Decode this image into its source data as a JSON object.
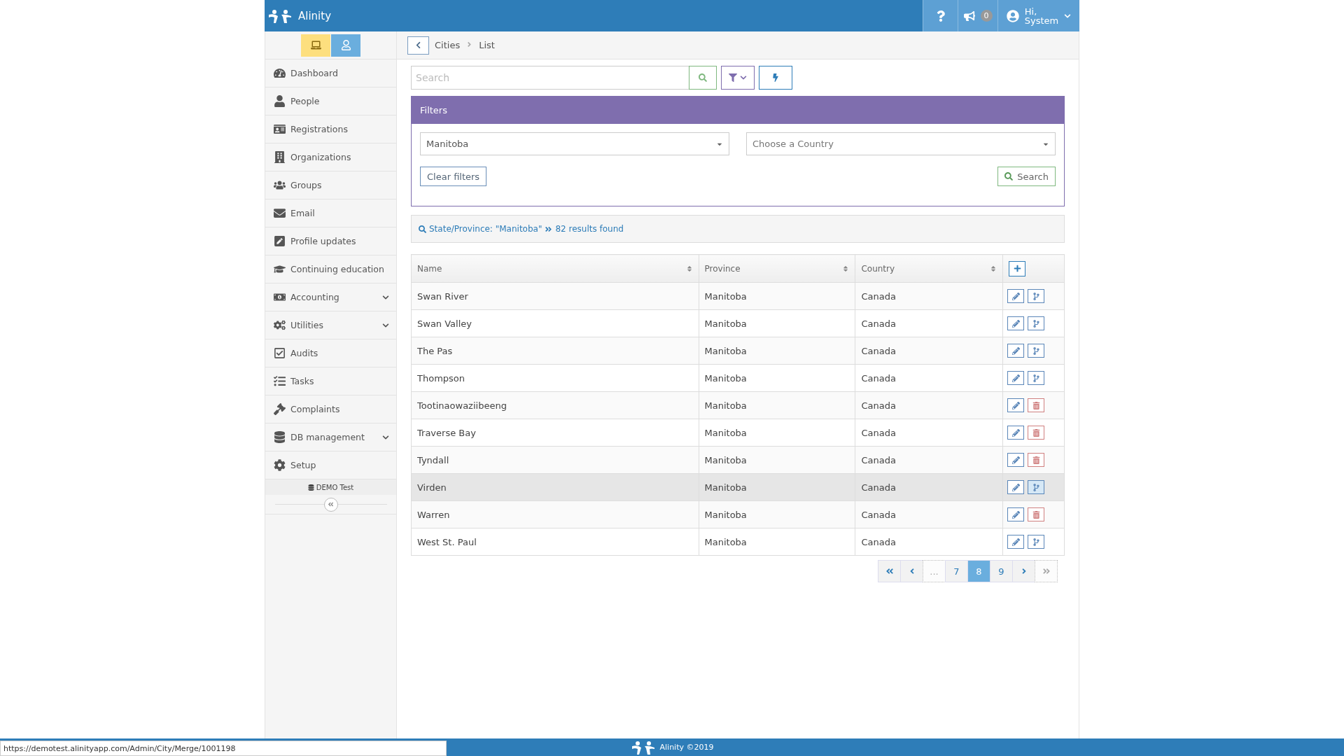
{
  "topbar": {
    "brand": "Alinity",
    "notifications": "0",
    "greeting": "Hi,",
    "user": "System"
  },
  "sidebar": {
    "toggles": [
      {
        "selected": true
      },
      {
        "selected": false
      }
    ],
    "items": [
      {
        "label": "Dashboard",
        "expandable": false
      },
      {
        "label": "People",
        "expandable": false
      },
      {
        "label": "Registrations",
        "expandable": false
      },
      {
        "label": "Organizations",
        "expandable": false
      },
      {
        "label": "Groups",
        "expandable": false
      },
      {
        "label": "Email",
        "expandable": false
      },
      {
        "label": "Profile updates",
        "expandable": false
      },
      {
        "label": "Continuing education",
        "expandable": false
      },
      {
        "label": "Accounting",
        "expandable": true
      },
      {
        "label": "Utilities",
        "expandable": true
      },
      {
        "label": "Audits",
        "expandable": false
      },
      {
        "label": "Tasks",
        "expandable": false
      },
      {
        "label": "Complaints",
        "expandable": false
      },
      {
        "label": "DB management",
        "expandable": true
      },
      {
        "label": "Setup",
        "expandable": false
      }
    ],
    "database": "DEMO Test"
  },
  "breadcrumb": [
    "Cities",
    "List"
  ],
  "search": {
    "placeholder": "Search"
  },
  "filters": {
    "title": "Filters",
    "state": "Manitoba",
    "country_placeholder": "Choose a Country",
    "clear": "Clear filters",
    "search": "Search"
  },
  "results": {
    "criteria": "State/Province: \"Manitoba\"",
    "count": "82 results found"
  },
  "table": {
    "columns": [
      "Name",
      "Province",
      "Country"
    ],
    "rows": [
      {
        "cells": [
          "Swan River",
          "Manitoba",
          "Canada"
        ],
        "kind": "merge",
        "hovered": false
      },
      {
        "cells": [
          "Swan Valley",
          "Manitoba",
          "Canada"
        ],
        "kind": "merge",
        "hovered": false
      },
      {
        "cells": [
          "The Pas",
          "Manitoba",
          "Canada"
        ],
        "kind": "merge",
        "hovered": false
      },
      {
        "cells": [
          "Thompson",
          "Manitoba",
          "Canada"
        ],
        "kind": "merge",
        "hovered": false
      },
      {
        "cells": [
          "Tootinaowaziibeeng",
          "Manitoba",
          "Canada"
        ],
        "kind": "delete",
        "hovered": false
      },
      {
        "cells": [
          "Traverse Bay",
          "Manitoba",
          "Canada"
        ],
        "kind": "delete",
        "hovered": false
      },
      {
        "cells": [
          "Tyndall",
          "Manitoba",
          "Canada"
        ],
        "kind": "delete",
        "hovered": false
      },
      {
        "cells": [
          "Virden",
          "Manitoba",
          "Canada"
        ],
        "kind": "merge",
        "hovered": true
      },
      {
        "cells": [
          "Warren",
          "Manitoba",
          "Canada"
        ],
        "kind": "delete",
        "hovered": false
      },
      {
        "cells": [
          "West St. Paul",
          "Manitoba",
          "Canada"
        ],
        "kind": "merge",
        "hovered": false
      }
    ]
  },
  "pagination": [
    {
      "kind": "first",
      "selected": false,
      "disabled": false
    },
    {
      "kind": "prev",
      "selected": false,
      "disabled": false
    },
    {
      "kind": "ellipsis",
      "label": "...",
      "selected": false,
      "disabled": true
    },
    {
      "kind": "page",
      "label": "7",
      "selected": false,
      "disabled": false
    },
    {
      "kind": "page",
      "label": "8",
      "selected": true,
      "disabled": false
    },
    {
      "kind": "page",
      "label": "9",
      "selected": false,
      "disabled": false
    },
    {
      "kind": "next",
      "selected": false,
      "disabled": false
    },
    {
      "kind": "last",
      "selected": false,
      "disabled": true
    }
  ],
  "footer": {
    "brand": "Alinity ©2019"
  },
  "status_url": "https://demotest.alinityapp.com/Admin/City/Merge/1001198"
}
